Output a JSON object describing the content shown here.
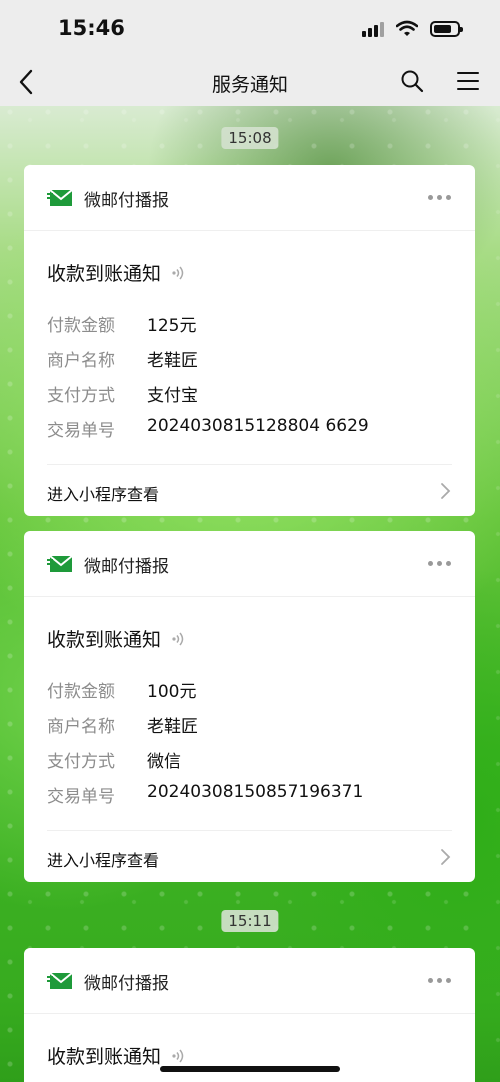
{
  "status_bar": {
    "time": "15:46"
  },
  "nav": {
    "title": "服务通知"
  },
  "messages": [
    {
      "time_chip": "15:08",
      "app_name": "微邮付播报",
      "title": "收款到账通知",
      "fields": [
        {
          "key": "付款金额",
          "value": "125元"
        },
        {
          "key": "商户名称",
          "value": "老鞋匠"
        },
        {
          "key": "支付方式",
          "value": "支付宝"
        },
        {
          "key": "交易单号",
          "value": "2024030815128804 6629"
        }
      ],
      "footer": "进入小程序查看"
    },
    {
      "app_name": "微邮付播报",
      "title": "收款到账通知",
      "fields": [
        {
          "key": "付款金额",
          "value": "100元"
        },
        {
          "key": "商户名称",
          "value": "老鞋匠"
        },
        {
          "key": "支付方式",
          "value": "微信"
        },
        {
          "key": "交易单号",
          "value": "20240308150857196371"
        }
      ],
      "footer": "进入小程序查看"
    },
    {
      "time_chip": "15:11",
      "app_name": "微邮付播报",
      "title": "收款到账通知"
    }
  ],
  "colors": {
    "brand_green": "#1e9a3a",
    "nav_bg": "#ededed"
  },
  "icons": [
    "back-icon",
    "search-icon",
    "menu-icon",
    "mail-logo-icon",
    "more-icon",
    "sound-icon",
    "chevron-right-icon"
  ]
}
